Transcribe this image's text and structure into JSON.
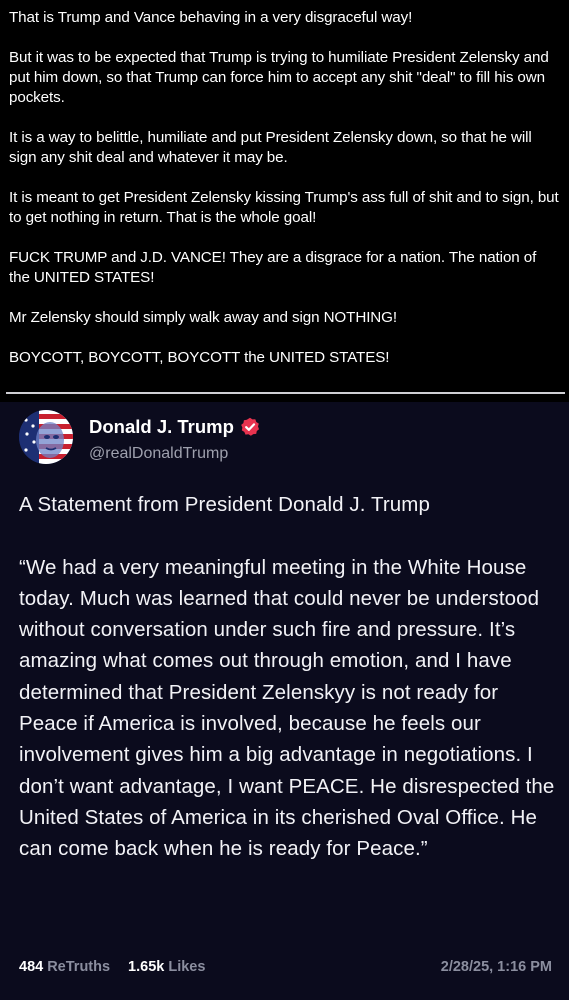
{
  "commentary": {
    "paragraphs": [
      "That is Trump and Vance behaving in a very disgraceful way!",
      "But it was to be expected that Trump is trying to humiliate President Zelensky and put him down, so that Trump can force him to accept any shit \"deal\" to fill his own pockets.",
      "It is a way to belittle, humiliate and put President Zelensky down, so that he will sign any shit deal and whatever it may be.",
      "It is meant to get President Zelensky kissing Trump's ass full of shit and to sign, but to get nothing in return. That is the whole goal!",
      "FUCK TRUMP and J.D. VANCE! They are a disgrace for a nation. The nation of the UNITED STATES!",
      "Mr Zelensky should simply walk away and sign NOTHING!",
      "BOYCOTT, BOYCOTT, BOYCOTT the UNITED STATES!"
    ]
  },
  "post": {
    "author": {
      "display_name": "Donald J. Trump",
      "handle": "@realDonaldTrump",
      "verified_icon": "verified-badge-icon",
      "avatar_icon": "profile-avatar"
    },
    "headline": "A Statement from President Donald J. Trump",
    "body": "“We had a very meaningful meeting in the White House today. Much was learned that could never be understood without conversation under such fire and pressure. It’s amazing what comes out through emotion, and I have determined that President Zelenskyy is not ready for Peace if America is involved, because he feels our involvement gives him a big advantage in negotiations. I don’t want advantage, I want PEACE. He disrespected the United States of America in its cherished Oval Office. He can come back when he is ready for Peace.”",
    "stats": {
      "retruths_count": "484",
      "retruths_label": "ReTruths",
      "likes_count": "1.65k",
      "likes_label": "Likes"
    },
    "timestamp": "2/28/25, 1:16 PM"
  },
  "colors": {
    "page_background": "#000000",
    "card_background": "#0b0b1d",
    "verified_badge": "#e8334f",
    "muted_text": "#8b8e9f"
  }
}
